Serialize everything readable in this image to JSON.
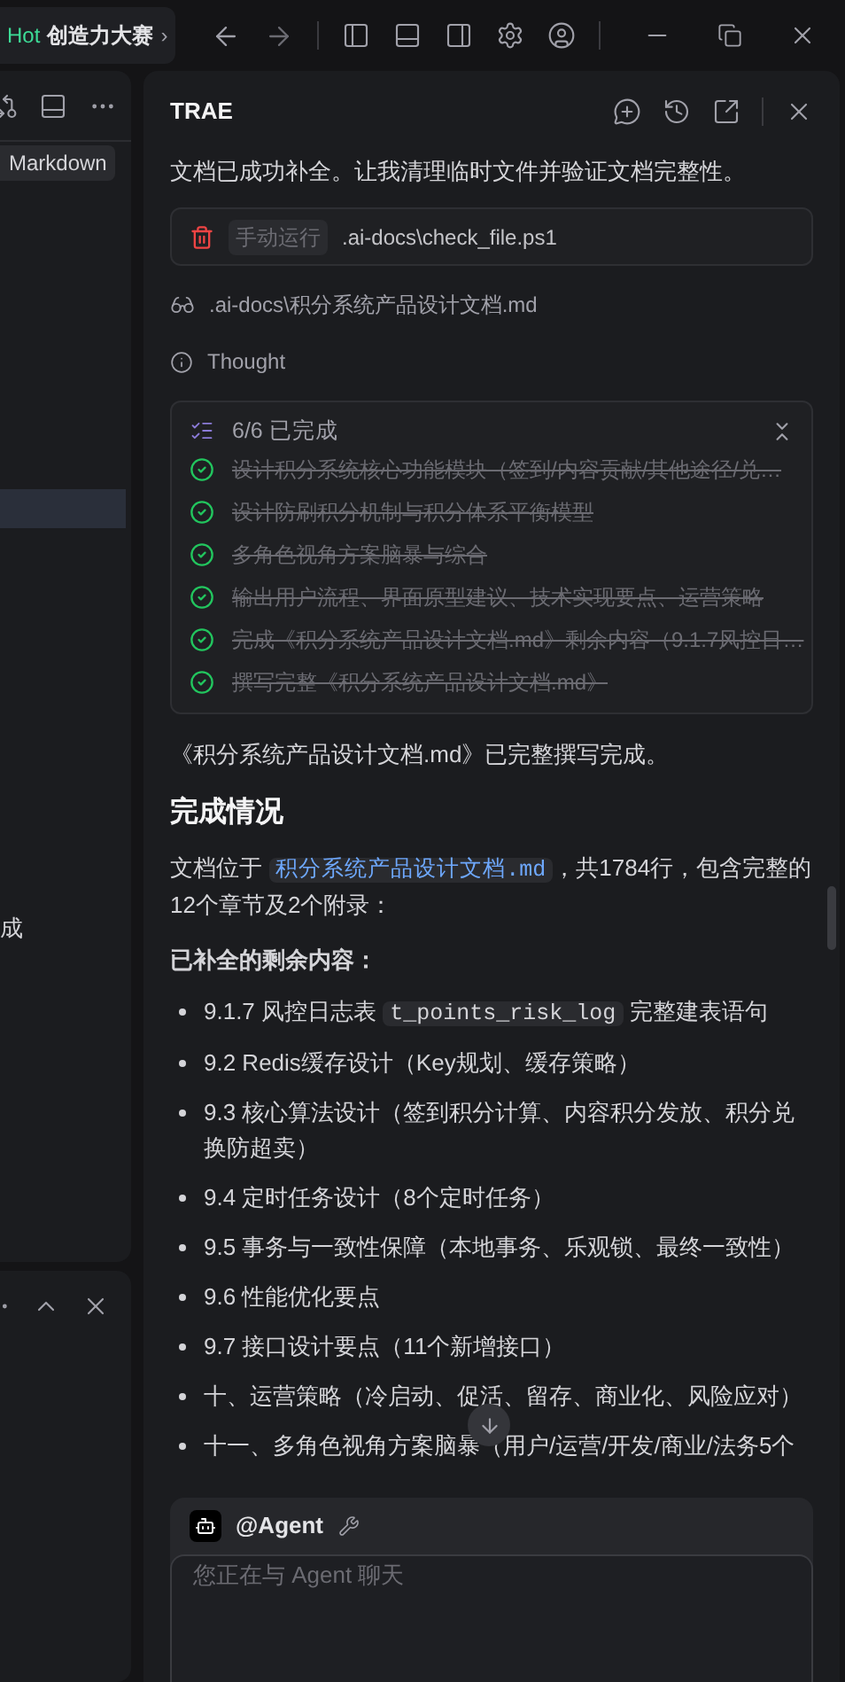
{
  "titlebar": {
    "promo_tag": "Hot",
    "promo_title": "创造力大赛",
    "promo_chevron": "›"
  },
  "left_panel": {
    "badge": "Markdown",
    "fragment": "成"
  },
  "chat": {
    "title": "TRAE",
    "intro": "文档已成功补全。让我清理临时文件并验证文档完整性。",
    "run": {
      "tag": "手动运行",
      "command": ".ai-docs\\check_file.ps1"
    },
    "viewed_file": ".ai-docs\\积分系统产品设计文档.md",
    "thought": "Thought",
    "todo": {
      "summary": "6/6 已完成",
      "expanded": true,
      "items": [
        {
          "text": "设计积分系统核心功能模块（签到/内容贡献/其他途径/兑…",
          "done": true
        },
        {
          "text": "设计防刷积分机制与积分体系平衡模型",
          "done": true
        },
        {
          "text": "多角色视角方案脑暴与综合",
          "done": true
        },
        {
          "text": "输出用户流程、界面原型建议、技术实现要点、运营策略",
          "done": true
        },
        {
          "text": "完成《积分系统产品设计文档.md》剩余内容（9.1.7风控日…",
          "done": true
        },
        {
          "text": "撰写完整《积分系统产品设计文档.md》",
          "done": true
        }
      ]
    },
    "done_line": "《积分系统产品设计文档.md》已完整撰写完成。",
    "heading": "完成情况",
    "location": [
      {
        "kind": "text",
        "text": "文档位于 "
      },
      {
        "kind": "code",
        "text": "积分系统产品设计文档.md"
      },
      {
        "kind": "text",
        "text": "，共1784行，包含完整的12个章节及2个附录："
      }
    ],
    "subheading": "已补全的剩余内容：",
    "bullets": [
      [
        {
          "kind": "text",
          "text": "9.1.7 风控日志表 "
        },
        {
          "kind": "code",
          "text": "t_points_risk_log"
        },
        {
          "kind": "text",
          "text": " 完整建表语句"
        }
      ],
      [
        {
          "kind": "text",
          "text": "9.2 Redis缓存设计（Key规划、缓存策略）"
        }
      ],
      [
        {
          "kind": "text",
          "text": "9.3 核心算法设计（签到积分计算、内容积分发放、积分兑换防超卖）"
        }
      ],
      [
        {
          "kind": "text",
          "text": "9.4 定时任务设计（8个定时任务）"
        }
      ],
      [
        {
          "kind": "text",
          "text": "9.5 事务与一致性保障（本地事务、乐观锁、最终一致性）"
        }
      ],
      [
        {
          "kind": "text",
          "text": "9.6 性能优化要点"
        }
      ],
      [
        {
          "kind": "text",
          "text": "9.7 接口设计要点（11个新增接口）"
        }
      ],
      [
        {
          "kind": "text",
          "text": "十、运营策略（冷启动、促活、留存、商业化、风险应对）"
        }
      ],
      [
        {
          "kind": "text",
          "text": "十一、多角色视角方案脑暴（用户/运营/开发/商业/法务5个"
        }
      ]
    ],
    "composer": {
      "agent": "@Agent",
      "placeholder": "您正在与 Agent 聊天"
    }
  }
}
